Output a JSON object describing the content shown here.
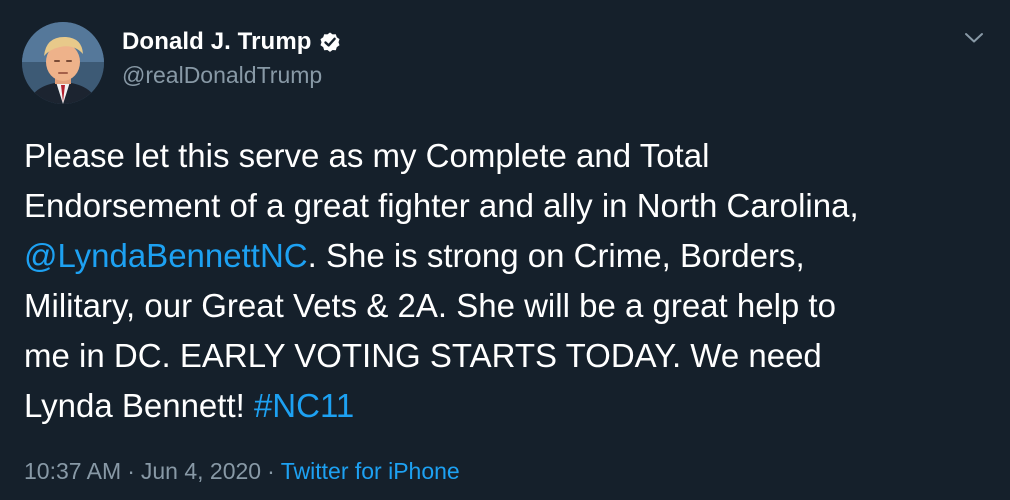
{
  "author": {
    "display_name": "Donald J. Trump",
    "handle": "@realDonaldTrump",
    "verified": true,
    "verified_icon": "verified-badge-icon"
  },
  "menu": {
    "icon": "chevron-down-icon"
  },
  "tweet": {
    "lines": [
      {
        "text": "Please let this serve as my Complete and Total"
      },
      {
        "text": "Endorsement of a great fighter and ally in North Carolina,"
      },
      {
        "mention": "@LyndaBennettNC",
        "text": ". She is strong on Crime, Borders,"
      },
      {
        "text": "Military, our Great Vets & 2A. She will be a great help to"
      },
      {
        "text": "me in DC. EARLY VOTING STARTS TODAY. We need"
      },
      {
        "text": "Lynda Bennett! ",
        "hashtag": "#NC11"
      }
    ]
  },
  "meta": {
    "time": "10:37 AM",
    "separator": "·",
    "date": "Jun 4, 2020",
    "source": "Twitter for iPhone"
  },
  "colors": {
    "background": "#15202b",
    "link": "#1da1f2",
    "secondary_text": "#8899a6"
  }
}
